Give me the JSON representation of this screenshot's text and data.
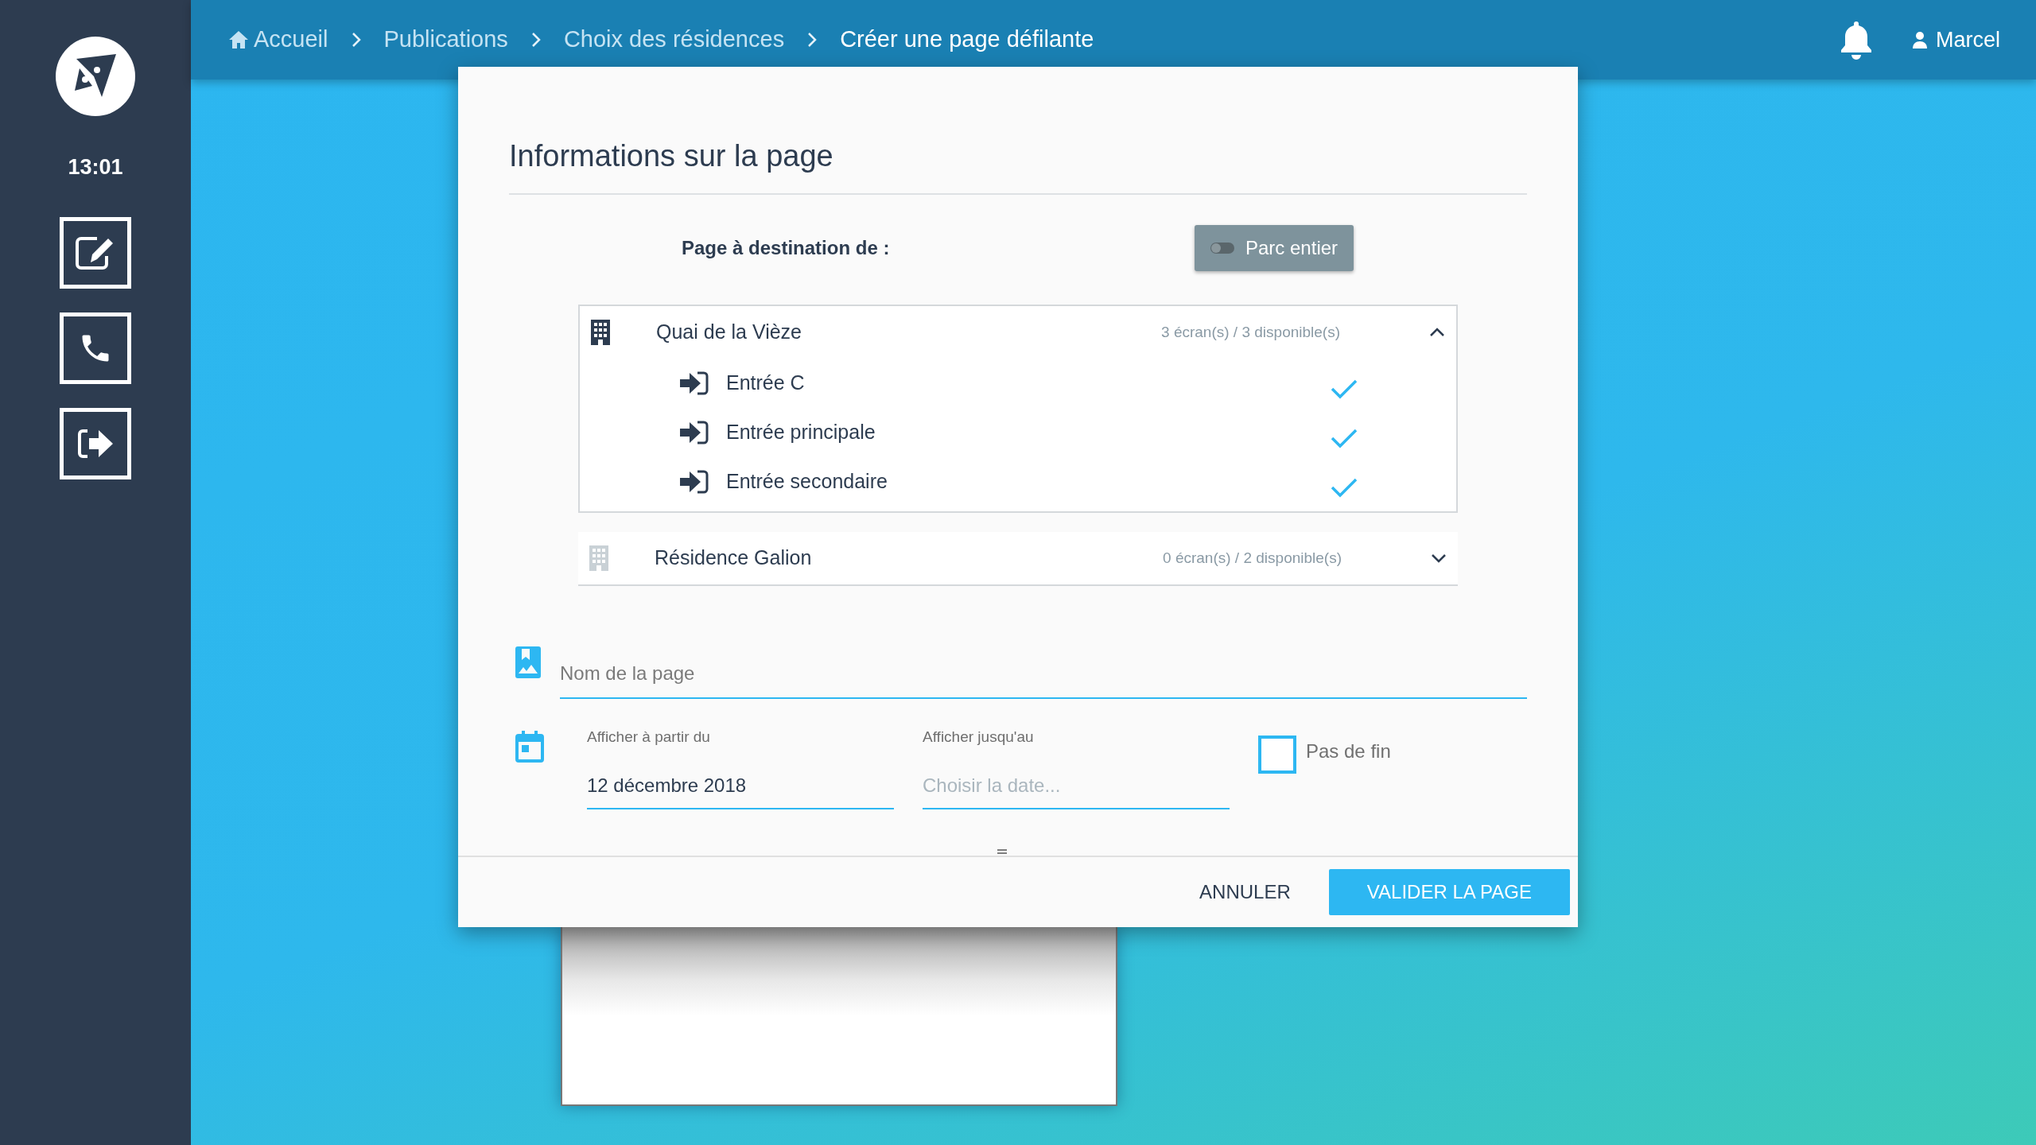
{
  "sidebar": {
    "time": "13:01",
    "buttons": [
      {
        "kind": "edit"
      },
      {
        "kind": "phone"
      },
      {
        "kind": "logout"
      }
    ]
  },
  "breadcrumb": [
    {
      "label": "Accueil",
      "kind": "home",
      "current": false
    },
    {
      "label": "Publications",
      "current": false
    },
    {
      "label": "Choix des résidences",
      "current": false
    },
    {
      "label": "Créer une page défilante",
      "current": true
    }
  ],
  "header": {
    "user": "Marcel"
  },
  "dialog": {
    "title": "Informations sur la page",
    "destination_label": "Page à destination de :",
    "toggle": {
      "label": "Parc entier",
      "on": false
    },
    "residences": [
      {
        "name": "Quai de la Vièze",
        "count": "3 écran(s) / 3 disponible(s)",
        "active": true,
        "expanded": true,
        "entrances": [
          {
            "name": "Entrée C",
            "checked": true
          },
          {
            "name": "Entrée principale",
            "checked": true
          },
          {
            "name": "Entrée secondaire",
            "checked": true
          }
        ]
      },
      {
        "name": "Résidence Galion",
        "count": "0 écran(s) / 2 disponible(s)",
        "active": false,
        "expanded": false
      }
    ],
    "page_name": {
      "placeholder": "Nom de la page"
    },
    "start_date": {
      "label": "Afficher à partir du",
      "value": "12 décembre 2018"
    },
    "end_date": {
      "label": "Afficher jusqu'au",
      "placeholder": "Choisir la date..."
    },
    "no_end": {
      "label": "Pas de fin",
      "checked": false
    },
    "buttons": [
      {
        "label": "ANNULER",
        "kind": "flat"
      },
      {
        "label": "VALIDER LA PAGE",
        "kind": "primary"
      }
    ]
  }
}
